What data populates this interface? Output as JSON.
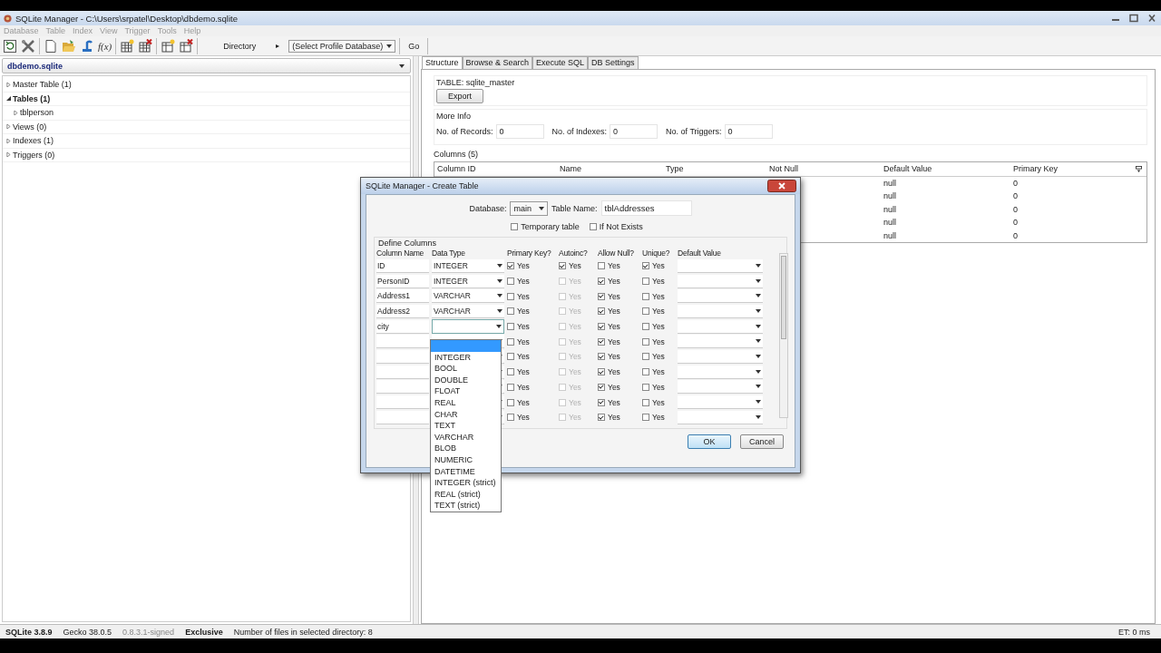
{
  "window": {
    "title": "SQLite Manager - C:\\Users\\srpatel\\Desktop\\dbdemo.sqlite"
  },
  "menu": [
    {
      "label": "Database",
      "disabled": true
    },
    {
      "label": "Table",
      "disabled": true
    },
    {
      "label": "Index",
      "disabled": true
    },
    {
      "label": "View",
      "disabled": true
    },
    {
      "label": "Trigger",
      "disabled": true
    },
    {
      "label": "Tools",
      "disabled": true
    },
    {
      "label": "Help",
      "disabled": true
    }
  ],
  "toolbar": {
    "function_button": "f(x)",
    "directory_label": "Directory",
    "directory_arrow": "▸",
    "profile_select": "(Select Profile Database)",
    "go_button": "Go"
  },
  "sidebar": {
    "database": "dbdemo.sqlite",
    "tree": [
      {
        "label": "Master Table (1)",
        "expanded": false
      },
      {
        "label": "Tables (1)",
        "expanded": true,
        "children": [
          {
            "label": "tblperson",
            "expanded": false
          }
        ]
      },
      {
        "label": "Views (0)",
        "expanded": false
      },
      {
        "label": "Indexes (1)",
        "expanded": false
      },
      {
        "label": "Triggers (0)",
        "expanded": false
      }
    ]
  },
  "tabs": [
    {
      "label": "Structure",
      "selected": true
    },
    {
      "label": "Browse & Search",
      "selected": false
    },
    {
      "label": "Execute SQL",
      "selected": false
    },
    {
      "label": "DB Settings",
      "selected": false
    }
  ],
  "structure": {
    "table_label": "TABLE: sqlite_master",
    "export_button": "Export",
    "more_info": "More Info",
    "info_fields": [
      {
        "label": "No. of Records:",
        "value": "0"
      },
      {
        "label": "No. of Indexes:",
        "value": "0"
      },
      {
        "label": "No. of Triggers:",
        "value": "0"
      }
    ],
    "columns_label": "Columns (5)",
    "table": {
      "columns": [
        "Column ID",
        "Name",
        "Type",
        "Not Null",
        "Default Value",
        "Primary Key"
      ],
      "rows": [
        {
          "default_value": "null",
          "primary_key": "0"
        },
        {
          "default_value": "null",
          "primary_key": "0"
        },
        {
          "default_value": "null",
          "primary_key": "0"
        },
        {
          "default_value": "null",
          "primary_key": "0"
        },
        {
          "default_value": "null",
          "primary_key": "0"
        }
      ]
    }
  },
  "dialog": {
    "title": "SQLite Manager - Create Table",
    "database_label": "Database:",
    "database_value": "main",
    "table_name_label": "Table Name:",
    "table_name_value": "tblAddresses",
    "options": [
      {
        "label": "Temporary table",
        "checked": false
      },
      {
        "label": "If Not Exists",
        "checked": false
      }
    ],
    "group_label": "Define Columns",
    "headers": [
      "Column Name",
      "Data Type",
      "Primary Key?",
      "Autoinc?",
      "Allow Null?",
      "Unique?",
      "Default Value"
    ],
    "rows": [
      {
        "name": "ID",
        "type": "INTEGER",
        "checks": [
          {
            "label": "Yes",
            "checked": true,
            "disabled": false
          },
          {
            "label": "Yes",
            "checked": true,
            "disabled": false
          },
          {
            "label": "Yes",
            "checked": false,
            "disabled": false
          },
          {
            "label": "Yes",
            "checked": true,
            "disabled": false
          }
        ]
      },
      {
        "name": "PersonID",
        "type": "INTEGER",
        "checks": [
          {
            "label": "Yes",
            "checked": false,
            "disabled": false
          },
          {
            "label": "Yes",
            "checked": false,
            "disabled": true
          },
          {
            "label": "Yes",
            "checked": true,
            "disabled": false
          },
          {
            "label": "Yes",
            "checked": false,
            "disabled": false
          }
        ]
      },
      {
        "name": "Address1",
        "type": "VARCHAR",
        "checks": [
          {
            "label": "Yes",
            "checked": false,
            "disabled": false
          },
          {
            "label": "Yes",
            "checked": false,
            "disabled": true
          },
          {
            "label": "Yes",
            "checked": true,
            "disabled": false
          },
          {
            "label": "Yes",
            "checked": false,
            "disabled": false
          }
        ]
      },
      {
        "name": "Address2",
        "type": "VARCHAR",
        "checks": [
          {
            "label": "Yes",
            "checked": false,
            "disabled": false
          },
          {
            "label": "Yes",
            "checked": false,
            "disabled": true
          },
          {
            "label": "Yes",
            "checked": true,
            "disabled": false
          },
          {
            "label": "Yes",
            "checked": false,
            "disabled": false
          }
        ]
      },
      {
        "name": "city",
        "checks": [
          {
            "label": "Yes",
            "checked": false,
            "disabled": false
          },
          {
            "label": "Yes",
            "checked": false,
            "disabled": true
          },
          {
            "label": "Yes",
            "checked": true,
            "disabled": false
          },
          {
            "label": "Yes",
            "checked": false,
            "disabled": false
          }
        ]
      },
      {
        "checks": [
          {
            "label": "Yes",
            "checked": false,
            "disabled": false
          },
          {
            "label": "Yes",
            "checked": false,
            "disabled": true
          },
          {
            "label": "Yes",
            "checked": true,
            "disabled": false
          },
          {
            "label": "Yes",
            "checked": false,
            "disabled": false
          }
        ]
      },
      {
        "checks": [
          {
            "label": "Yes",
            "checked": false,
            "disabled": false
          },
          {
            "label": "Yes",
            "checked": false,
            "disabled": true
          },
          {
            "label": "Yes",
            "checked": true,
            "disabled": false
          },
          {
            "label": "Yes",
            "checked": false,
            "disabled": false
          }
        ]
      },
      {
        "checks": [
          {
            "label": "Yes",
            "checked": false,
            "disabled": false
          },
          {
            "label": "Yes",
            "checked": false,
            "disabled": true
          },
          {
            "label": "Yes",
            "checked": true,
            "disabled": false
          },
          {
            "label": "Yes",
            "checked": false,
            "disabled": false
          }
        ]
      },
      {
        "checks": [
          {
            "label": "Yes",
            "checked": false,
            "disabled": false
          },
          {
            "label": "Yes",
            "checked": false,
            "disabled": true
          },
          {
            "label": "Yes",
            "checked": true,
            "disabled": false
          },
          {
            "label": "Yes",
            "checked": false,
            "disabled": false
          }
        ]
      },
      {
        "checks": [
          {
            "label": "Yes",
            "checked": false,
            "disabled": false
          },
          {
            "label": "Yes",
            "checked": false,
            "disabled": true
          },
          {
            "label": "Yes",
            "checked": true,
            "disabled": false
          },
          {
            "label": "Yes",
            "checked": false,
            "disabled": false
          }
        ]
      },
      {
        "checks": [
          {
            "label": "Yes",
            "checked": false,
            "disabled": false
          },
          {
            "label": "Yes",
            "checked": false,
            "disabled": true
          },
          {
            "label": "Yes",
            "checked": true,
            "disabled": false
          },
          {
            "label": "Yes",
            "checked": false,
            "disabled": false
          }
        ]
      }
    ],
    "type_options": [
      {
        "selected": true
      },
      {
        "label": "INTEGER",
        "selected": false
      },
      {
        "label": "BOOL",
        "selected": false
      },
      {
        "label": "DOUBLE",
        "selected": false
      },
      {
        "label": "FLOAT",
        "selected": false
      },
      {
        "label": "REAL",
        "selected": false
      },
      {
        "label": "CHAR",
        "selected": false
      },
      {
        "label": "TEXT",
        "selected": false
      },
      {
        "label": "VARCHAR",
        "selected": false
      },
      {
        "label": "BLOB",
        "selected": false
      },
      {
        "label": "NUMERIC",
        "selected": false
      },
      {
        "label": "DATETIME",
        "selected": false
      },
      {
        "label": "INTEGER (strict)",
        "selected": false
      },
      {
        "label": "REAL (strict)",
        "selected": false
      },
      {
        "label": "TEXT (strict)",
        "selected": false
      }
    ],
    "buttons": [
      {
        "label": "OK",
        "kind": "default"
      },
      {
        "label": "Cancel",
        "kind": "normal"
      }
    ]
  },
  "status_bar": [
    {
      "text": "SQLite 3.8.9",
      "kind": "bold"
    },
    {
      "text": "Gecko 38.0.5",
      "kind": "normal"
    },
    {
      "text": "0.8.3.1-signed",
      "kind": "muted"
    },
    {
      "text": "Exclusive",
      "kind": "bold"
    },
    {
      "text": "Number of files in selected directory: 8",
      "kind": "normal"
    },
    {
      "text": "ET: 0 ms",
      "kind": "right"
    }
  ]
}
